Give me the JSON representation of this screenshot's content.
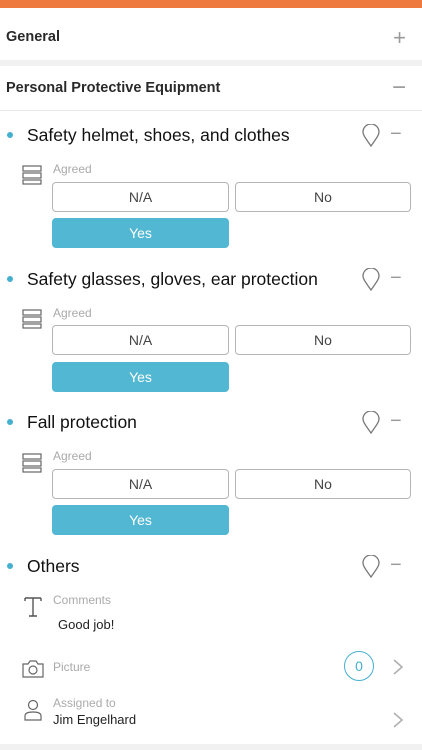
{
  "sections": {
    "general": {
      "title": "General",
      "toggle": "+"
    },
    "ppe": {
      "title": "Personal  Protective Equipment",
      "toggle": "−"
    }
  },
  "items": [
    {
      "title": "Safety helmet, shoes, and clothes",
      "field_label": "Agreed",
      "options": [
        "N/A",
        "No",
        "Yes"
      ],
      "selected": "Yes"
    },
    {
      "title": "Safety glasses, gloves, ear protection",
      "field_label": "Agreed",
      "options": [
        "N/A",
        "No",
        "Yes"
      ],
      "selected": "Yes"
    },
    {
      "title": "Fall protection",
      "field_label": "Agreed",
      "options": [
        "N/A",
        "No",
        "Yes"
      ],
      "selected": "Yes"
    }
  ],
  "others": {
    "title": "Others",
    "comments": {
      "label": "Comments",
      "value": "Good job!"
    },
    "picture": {
      "label": "Picture",
      "count": "0"
    },
    "assigned": {
      "label": "Assigned to",
      "value": "Jim Engelhard"
    }
  },
  "item_minus": "−",
  "colors": {
    "accent_bar": "#ee7a3f",
    "selected": "#52b7d2",
    "dot": "#45afd0"
  },
  "icons": [
    "location-pin-icon",
    "list-icon",
    "text-icon",
    "camera-icon",
    "person-icon",
    "chevron-right-icon"
  ]
}
